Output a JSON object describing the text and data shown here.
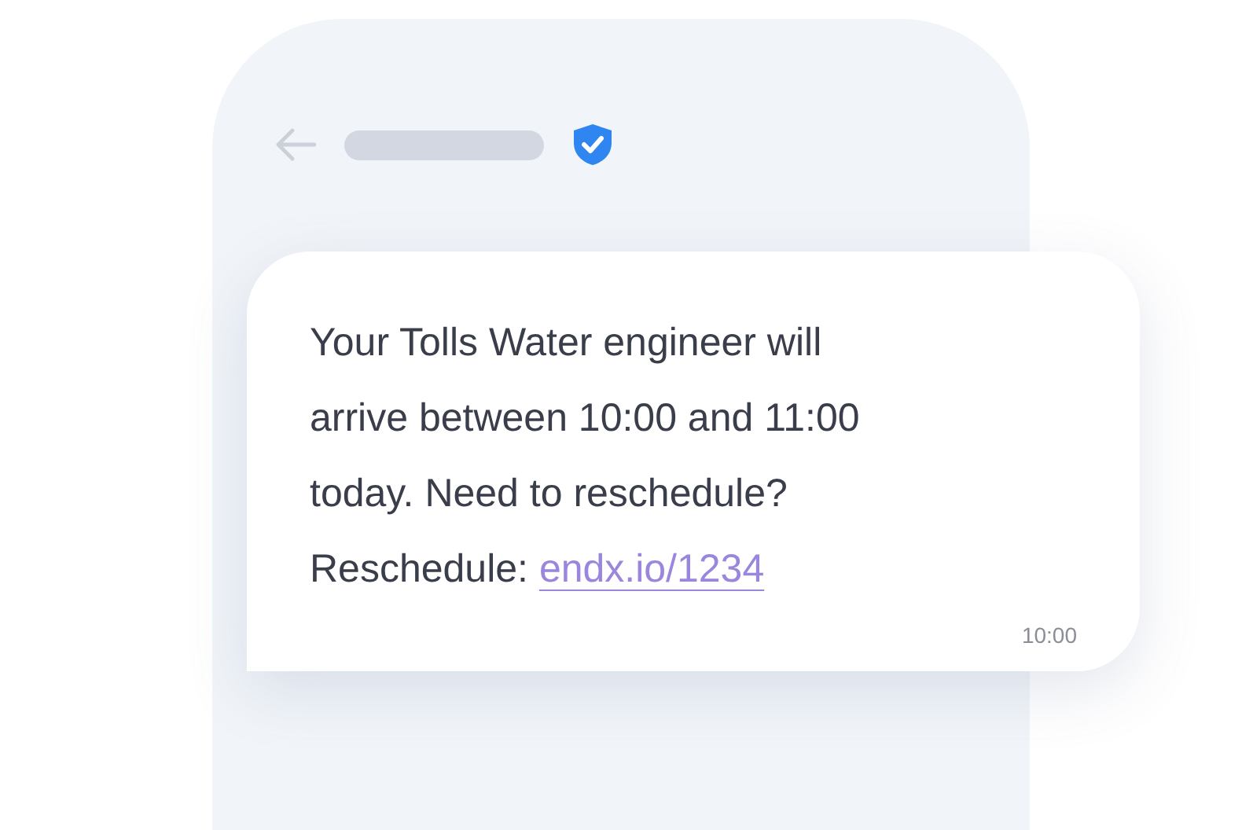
{
  "message": {
    "lines": [
      "Your Tolls Water engineer will",
      "arrive between 10:00 and 11:00",
      "today. Need to reschedule?"
    ],
    "link_prefix": "Reschedule:",
    "link": "endx.io/1234",
    "time": "10:00"
  }
}
